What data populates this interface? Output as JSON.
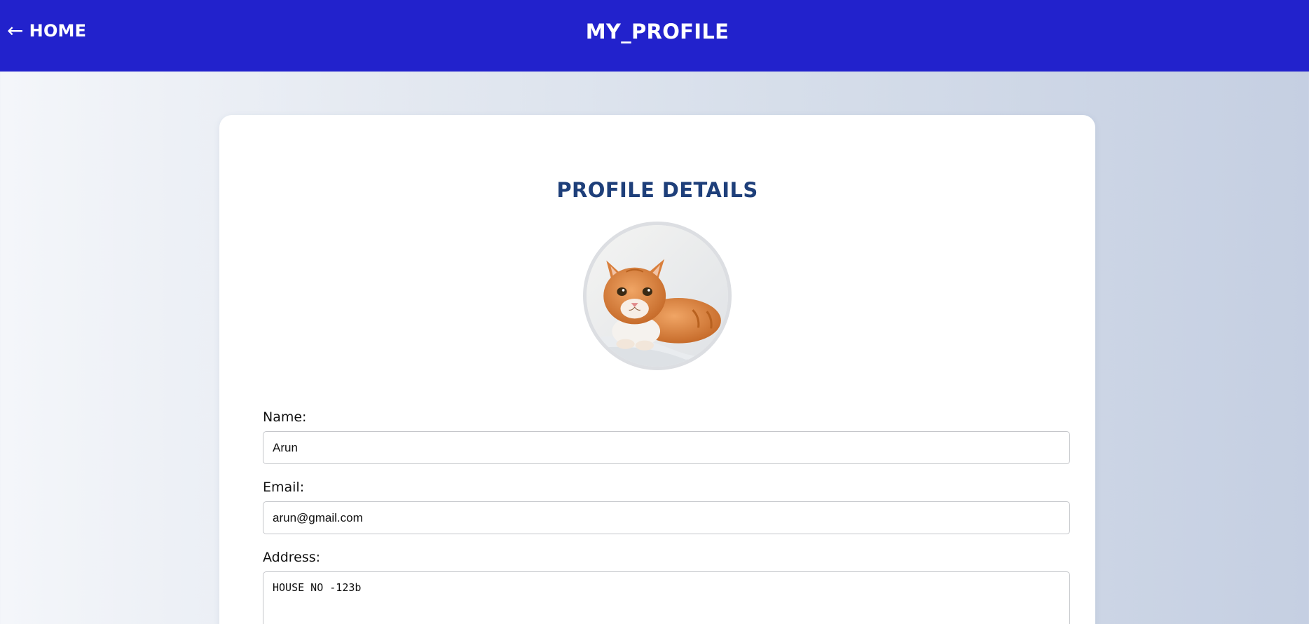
{
  "header": {
    "home_arrow": "←",
    "home_label": "HOME",
    "title": "MY_PROFILE",
    "background_color": "#2222cc"
  },
  "profile": {
    "heading": "PROFILE DETAILS",
    "avatar_icon": "cat-photo",
    "fields": [
      {
        "label": "Name:",
        "value": "Arun"
      },
      {
        "label": "Email:",
        "value": "arun@gmail.com"
      },
      {
        "label": "Address:",
        "value": "HOUSE NO -123b"
      }
    ]
  },
  "colors": {
    "heading": "#1e3f7a",
    "topbar": "#2222cc"
  }
}
